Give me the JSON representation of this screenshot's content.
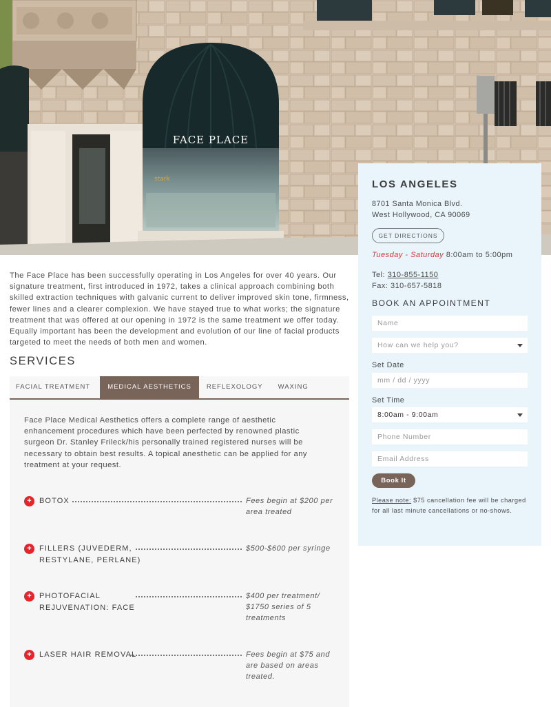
{
  "hero": {
    "storefront_sign": "FACE PLACE",
    "window_text": "stark"
  },
  "intro": "The Face Place has been successfully operating in Los Angeles for over 40 years. Our signature treatment, first introduced in 1972, takes a clinical approach combining both skilled extraction techniques with galvanic current to deliver improved skin tone, firmness, fewer lines and a clearer complexion. We have stayed true to what works; the signature treatment that was offered at our opening in 1972 is the same treatment we offer today. Equally important has been the development and evolution of our line of facial products targeted to meet the needs of both men and women.",
  "services": {
    "title": "SERVICES",
    "tabs": [
      {
        "label": "FACIAL TREATMENT"
      },
      {
        "label": "MEDICAL AESTHETICS"
      },
      {
        "label": "REFLEXOLOGY"
      },
      {
        "label": "WAXING"
      }
    ],
    "active_tab": "MEDICAL AESTHETICS",
    "description": "Face Place Medical Aesthetics offers a complete range of aesthetic enhancement procedures which have been perfected by renowned plastic surgeon Dr. Stanley Frileck/his personally trained registered nurses will be necessary to obtain best results. A topical anesthetic can be applied for any treatment at your request.",
    "items": [
      {
        "name": "BOTOX",
        "price": "Fees begin at $200 per area treated"
      },
      {
        "name": "FILLERS (JUVEDERM, RESTYLANE, PERLANE)",
        "price": "$500-$600 per syringe"
      },
      {
        "name": "PHOTOFACIAL REJUVENATION: FACE",
        "price": "$400 per treatment/ $1750 series of 5 treatments"
      },
      {
        "name": "LASER HAIR REMOVAL",
        "price": "Fees begin at $75 and are based on areas treated."
      }
    ]
  },
  "sidebar": {
    "location_title": "LOS ANGELES",
    "address_line1": "8701 Santa Monica Blvd.",
    "address_line2": "West Hollywood, CA 90069",
    "directions_label": "GET DIRECTIONS",
    "hours_days": "Tuesday - Saturday",
    "hours_time": " 8:00am to 5:00pm",
    "tel_label": "Tel: ",
    "tel": "310-855-1150",
    "fax": "Fax: 310-657-5818",
    "book_title": "BOOK AN APPOINTMENT",
    "name_placeholder": "Name",
    "help_placeholder": "How can we help you?",
    "date_label": "Set Date",
    "date_placeholder": "mm / dd / yyyy",
    "time_label": "Set Time",
    "time_value": "8:00am - 9:00am",
    "phone_placeholder": "Phone Number",
    "email_placeholder": "Email Address",
    "book_button": "Book It",
    "note_label": "Please note:",
    "note_text": " $75 cancellation fee will be charged for all last minute cancellations or no-shows."
  },
  "colors": {
    "accent_brown": "#786459",
    "sidebar_bg": "#e9f5fb",
    "plus_red": "#e8232b",
    "hours_red": "#d23a3a"
  }
}
